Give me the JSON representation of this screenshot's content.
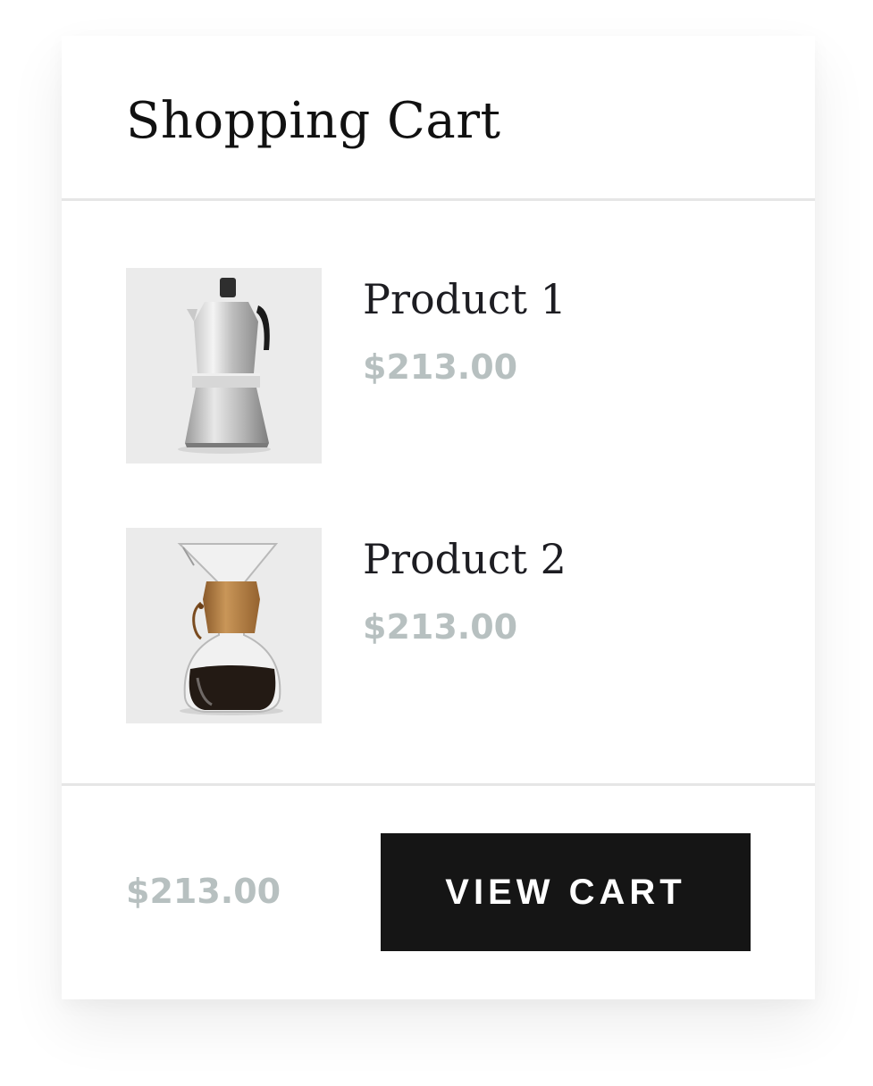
{
  "cart": {
    "title": "Shopping Cart",
    "items": [
      {
        "name": "Product 1",
        "price": "$213.00",
        "image_icon": "moka-pot-image"
      },
      {
        "name": "Product 2",
        "price": "$213.00",
        "image_icon": "chemex-coffee-maker-image"
      }
    ],
    "subtotal": "$213.00",
    "view_cart_label": "VIEW CART"
  },
  "colors": {
    "button_background": "#151515",
    "button_text": "#ffffff",
    "price_text": "#b7c0c0",
    "divider": "#e6e6e6",
    "thumbnail_background": "#ebebeb"
  }
}
